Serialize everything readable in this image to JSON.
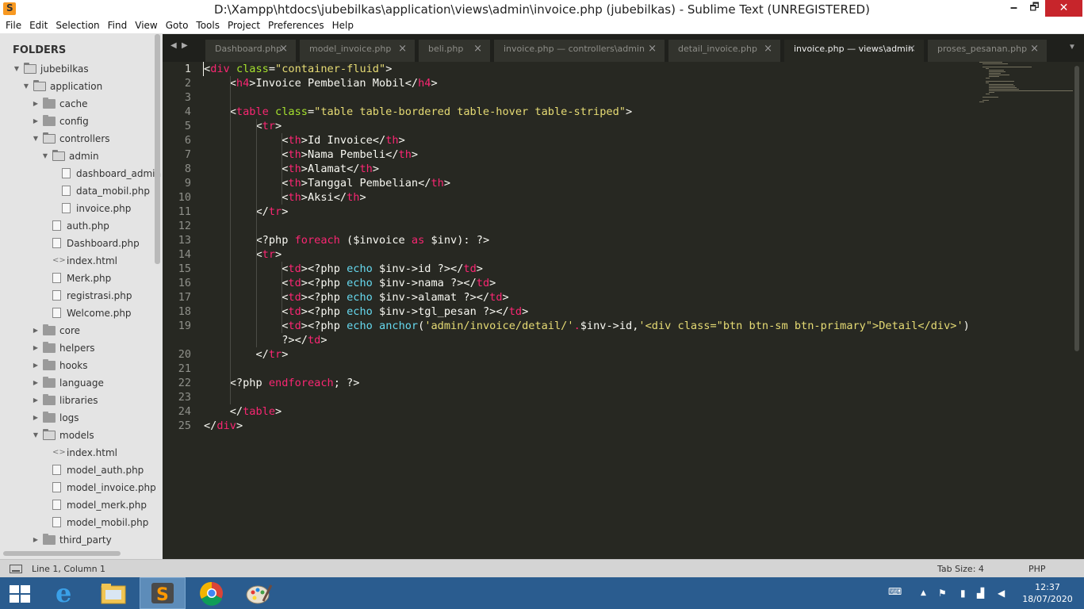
{
  "window": {
    "title": "D:\\Xampp\\htdocs\\jubebilkas\\application\\views\\admin\\invoice.php (jubebilkas) - Sublime Text (UNREGISTERED)",
    "min_label": "🗕",
    "max_label": "🗗",
    "close_label": "✕"
  },
  "menu": [
    "File",
    "Edit",
    "Selection",
    "Find",
    "View",
    "Goto",
    "Tools",
    "Project",
    "Preferences",
    "Help"
  ],
  "sidebar": {
    "title": "FOLDERS",
    "items": [
      {
        "label": "jubebilkas",
        "type": "folder-open",
        "depth": 0,
        "expanded": true
      },
      {
        "label": "application",
        "type": "folder-open",
        "depth": 1,
        "expanded": true
      },
      {
        "label": "cache",
        "type": "folder",
        "depth": 2,
        "expanded": false
      },
      {
        "label": "config",
        "type": "folder",
        "depth": 2,
        "expanded": false
      },
      {
        "label": "controllers",
        "type": "folder-open",
        "depth": 2,
        "expanded": true
      },
      {
        "label": "admin",
        "type": "folder-open",
        "depth": 3,
        "expanded": true
      },
      {
        "label": "dashboard_admin",
        "type": "file",
        "depth": 4
      },
      {
        "label": "data_mobil.php",
        "type": "file",
        "depth": 4
      },
      {
        "label": "invoice.php",
        "type": "file",
        "depth": 4
      },
      {
        "label": "auth.php",
        "type": "file",
        "depth": 3
      },
      {
        "label": "Dashboard.php",
        "type": "file",
        "depth": 3
      },
      {
        "label": "index.html",
        "type": "code",
        "depth": 3
      },
      {
        "label": "Merk.php",
        "type": "file",
        "depth": 3
      },
      {
        "label": "registrasi.php",
        "type": "file",
        "depth": 3
      },
      {
        "label": "Welcome.php",
        "type": "file",
        "depth": 3
      },
      {
        "label": "core",
        "type": "folder",
        "depth": 2,
        "expanded": false
      },
      {
        "label": "helpers",
        "type": "folder",
        "depth": 2,
        "expanded": false
      },
      {
        "label": "hooks",
        "type": "folder",
        "depth": 2,
        "expanded": false
      },
      {
        "label": "language",
        "type": "folder",
        "depth": 2,
        "expanded": false
      },
      {
        "label": "libraries",
        "type": "folder",
        "depth": 2,
        "expanded": false
      },
      {
        "label": "logs",
        "type": "folder",
        "depth": 2,
        "expanded": false
      },
      {
        "label": "models",
        "type": "folder-open",
        "depth": 2,
        "expanded": true
      },
      {
        "label": "index.html",
        "type": "code",
        "depth": 3
      },
      {
        "label": "model_auth.php",
        "type": "file",
        "depth": 3
      },
      {
        "label": "model_invoice.php",
        "type": "file",
        "depth": 3
      },
      {
        "label": "model_merk.php",
        "type": "file",
        "depth": 3
      },
      {
        "label": "model_mobil.php",
        "type": "file",
        "depth": 3
      },
      {
        "label": "third_party",
        "type": "folder",
        "depth": 2,
        "expanded": false
      }
    ]
  },
  "tabs": [
    {
      "label": "Dashboard.php",
      "active": false
    },
    {
      "label": "model_invoice.php",
      "active": false
    },
    {
      "label": "beli.php",
      "active": false
    },
    {
      "label": "invoice.php — controllers\\admin",
      "active": false
    },
    {
      "label": "detail_invoice.php",
      "active": false
    },
    {
      "label": "invoice.php — views\\admin",
      "active": true
    },
    {
      "label": "proses_pesanan.php",
      "active": false
    }
  ],
  "editor": {
    "line_numbers": [
      "1",
      "2",
      "3",
      "4",
      "5",
      "6",
      "7",
      "8",
      "9",
      "10",
      "11",
      "12",
      "13",
      "14",
      "15",
      "16",
      "17",
      "18",
      "19",
      "",
      "20",
      "21",
      "22",
      "23",
      "24",
      "25"
    ],
    "code_lines": [
      [
        [
          "<",
          "p"
        ],
        [
          "div",
          "tag"
        ],
        [
          " ",
          "p"
        ],
        [
          "class",
          "attr"
        ],
        [
          "=",
          "p"
        ],
        [
          "\"container-fluid\"",
          "str"
        ],
        [
          ">",
          "p"
        ]
      ],
      [
        [
          "    <",
          "p"
        ],
        [
          "h4",
          "tag"
        ],
        [
          ">Invoice Pembelian Mobil</",
          "p"
        ],
        [
          "h4",
          "tag"
        ],
        [
          ">",
          "p"
        ]
      ],
      [],
      [
        [
          "    <",
          "p"
        ],
        [
          "table",
          "tag"
        ],
        [
          " ",
          "p"
        ],
        [
          "class",
          "attr"
        ],
        [
          "=",
          "p"
        ],
        [
          "\"table table-bordered table-hover table-striped\"",
          "str"
        ],
        [
          ">",
          "p"
        ]
      ],
      [
        [
          "        <",
          "p"
        ],
        [
          "tr",
          "tag"
        ],
        [
          ">",
          "p"
        ]
      ],
      [
        [
          "            <",
          "p"
        ],
        [
          "th",
          "tag"
        ],
        [
          ">Id Invoice</",
          "p"
        ],
        [
          "th",
          "tag"
        ],
        [
          ">",
          "p"
        ]
      ],
      [
        [
          "            <",
          "p"
        ],
        [
          "th",
          "tag"
        ],
        [
          ">Nama Pembeli</",
          "p"
        ],
        [
          "th",
          "tag"
        ],
        [
          ">",
          "p"
        ]
      ],
      [
        [
          "            <",
          "p"
        ],
        [
          "th",
          "tag"
        ],
        [
          ">Alamat</",
          "p"
        ],
        [
          "th",
          "tag"
        ],
        [
          ">",
          "p"
        ]
      ],
      [
        [
          "            <",
          "p"
        ],
        [
          "th",
          "tag"
        ],
        [
          ">Tanggal Pembelian</",
          "p"
        ],
        [
          "th",
          "tag"
        ],
        [
          ">",
          "p"
        ]
      ],
      [
        [
          "            <",
          "p"
        ],
        [
          "th",
          "tag"
        ],
        [
          ">Aksi</",
          "p"
        ],
        [
          "th",
          "tag"
        ],
        [
          ">",
          "p"
        ]
      ],
      [
        [
          "        </",
          "p"
        ],
        [
          "tr",
          "tag"
        ],
        [
          ">",
          "p"
        ]
      ],
      [],
      [
        [
          "        <?php ",
          "p"
        ],
        [
          "foreach",
          "kw"
        ],
        [
          " ($invoice ",
          "p"
        ],
        [
          "as",
          "kw"
        ],
        [
          " $inv): ?>",
          "p"
        ]
      ],
      [
        [
          "        <",
          "p"
        ],
        [
          "tr",
          "tag"
        ],
        [
          ">",
          "p"
        ]
      ],
      [
        [
          "            <",
          "p"
        ],
        [
          "td",
          "tag"
        ],
        [
          "><?php ",
          "p"
        ],
        [
          "echo",
          "fn"
        ],
        [
          " $inv->id ?></",
          "p"
        ],
        [
          "td",
          "tag"
        ],
        [
          ">",
          "p"
        ]
      ],
      [
        [
          "            <",
          "p"
        ],
        [
          "td",
          "tag"
        ],
        [
          "><?php ",
          "p"
        ],
        [
          "echo",
          "fn"
        ],
        [
          " $inv->nama ?></",
          "p"
        ],
        [
          "td",
          "tag"
        ],
        [
          ">",
          "p"
        ]
      ],
      [
        [
          "            <",
          "p"
        ],
        [
          "td",
          "tag"
        ],
        [
          "><?php ",
          "p"
        ],
        [
          "echo",
          "fn"
        ],
        [
          " $inv->alamat ?></",
          "p"
        ],
        [
          "td",
          "tag"
        ],
        [
          ">",
          "p"
        ]
      ],
      [
        [
          "            <",
          "p"
        ],
        [
          "td",
          "tag"
        ],
        [
          "><?php ",
          "p"
        ],
        [
          "echo",
          "fn"
        ],
        [
          " $inv->tgl_pesan ?></",
          "p"
        ],
        [
          "td",
          "tag"
        ],
        [
          ">",
          "p"
        ]
      ],
      [
        [
          "            <",
          "p"
        ],
        [
          "td",
          "tag"
        ],
        [
          "><?php ",
          "p"
        ],
        [
          "echo",
          "fn"
        ],
        [
          " ",
          "p"
        ],
        [
          "anchor",
          "call"
        ],
        [
          "(",
          "p"
        ],
        [
          "'admin/invoice/detail/'",
          "str"
        ],
        [
          ".",
          "kw"
        ],
        [
          "$inv->id,",
          "p"
        ],
        [
          "'<div class=\"btn btn-sm btn-primary\">Detail</div>'",
          "str"
        ],
        [
          ")",
          "p"
        ]
      ],
      [
        [
          "            ?></",
          "p"
        ],
        [
          "td",
          "tag"
        ],
        [
          ">",
          "p"
        ]
      ],
      [
        [
          "        </",
          "p"
        ],
        [
          "tr",
          "tag"
        ],
        [
          ">",
          "p"
        ]
      ],
      [],
      [
        [
          "    <?php ",
          "p"
        ],
        [
          "endforeach",
          "kw"
        ],
        [
          "; ?>",
          "p"
        ]
      ],
      [],
      [
        [
          "    </",
          "p"
        ],
        [
          "table",
          "tag"
        ],
        [
          ">",
          "p"
        ]
      ],
      [
        [
          "</",
          "p"
        ],
        [
          "div",
          "tag"
        ],
        [
          ">",
          "p"
        ]
      ]
    ]
  },
  "status": {
    "position": "Line 1, Column 1",
    "tab_size": "Tab Size: 4",
    "syntax": "PHP"
  },
  "taskbar": {
    "time": "12:37",
    "date": "18/07/2020"
  },
  "colors": {
    "editor_bg": "#272822",
    "tag": "#f92672",
    "attr": "#a6e22e",
    "string": "#e6db74",
    "function": "#66d9ef",
    "taskbar": "#2a5c8f",
    "close_button": "#c7252b"
  }
}
